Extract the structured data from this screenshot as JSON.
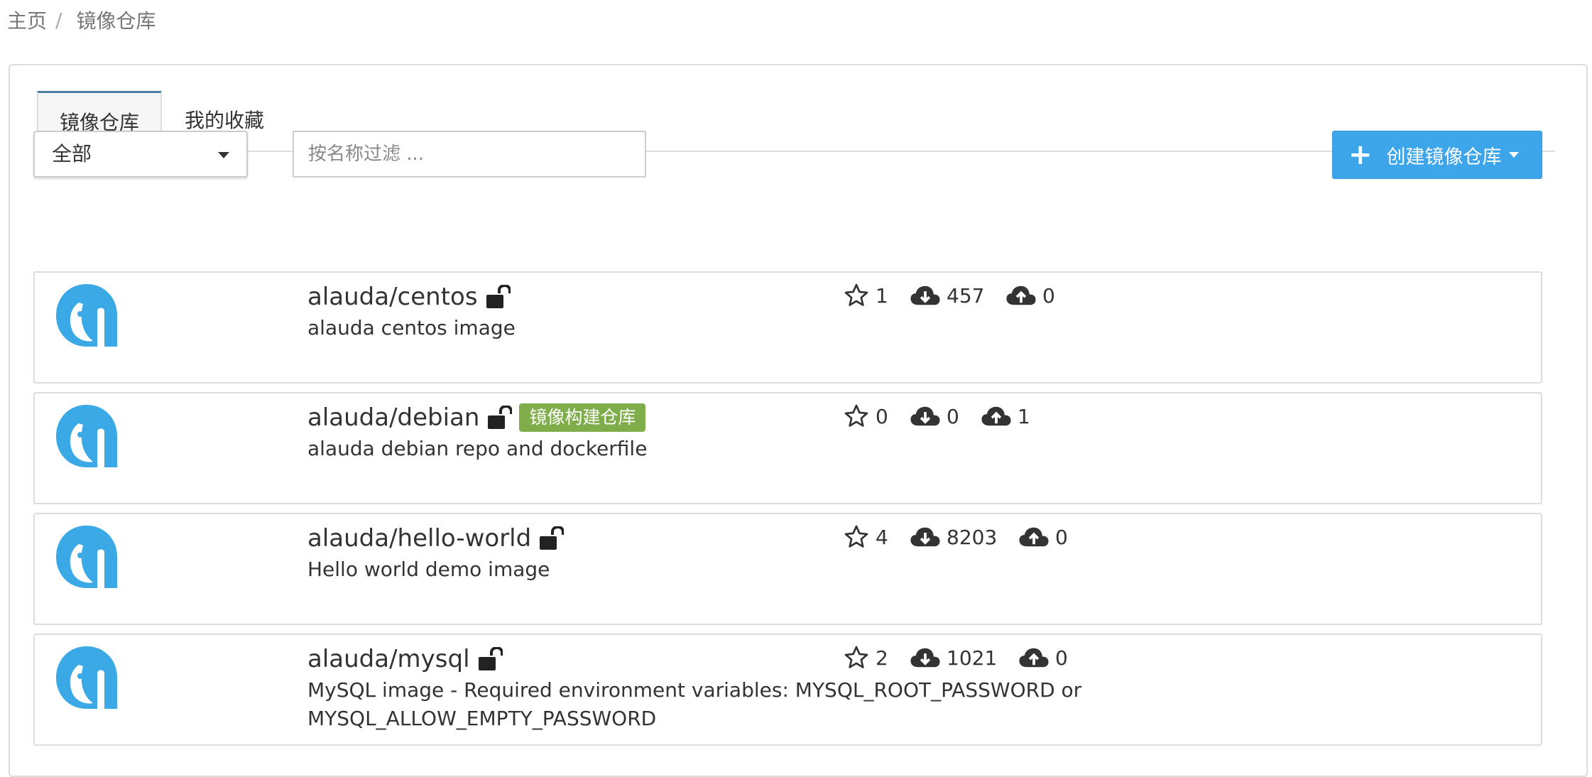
{
  "breadcrumb": {
    "home": "主页",
    "separator": "/",
    "current": "镜像仓库"
  },
  "tabs": [
    {
      "label": "镜像仓库",
      "active": true
    },
    {
      "label": "我的收藏",
      "active": false
    }
  ],
  "filter_select": {
    "value": "全部"
  },
  "search": {
    "placeholder": "按名称过滤 ...",
    "value": ""
  },
  "create_button": {
    "label": "创建镜像仓库"
  },
  "colors": {
    "accent": "#3da5ea",
    "badge": "#7fad4a",
    "logo": "#3aa9e5"
  },
  "repos": [
    {
      "name": "alauda/centos",
      "badge": "",
      "description": "alauda centos image",
      "stars": "1",
      "pulls": "457",
      "pushes": "0"
    },
    {
      "name": "alauda/debian",
      "badge": "镜像构建仓库",
      "description": "alauda debian repo and dockerfile",
      "stars": "0",
      "pulls": "0",
      "pushes": "1"
    },
    {
      "name": "alauda/hello-world",
      "badge": "",
      "description": "Hello world demo image",
      "stars": "4",
      "pulls": "8203",
      "pushes": "0"
    },
    {
      "name": "alauda/mysql",
      "badge": "",
      "description": "MySQL image - Required environment variables: MYSQL_ROOT_PASSWORD or MYSQL_ALLOW_EMPTY_PASSWORD",
      "stars": "2",
      "pulls": "1021",
      "pushes": "0"
    }
  ]
}
